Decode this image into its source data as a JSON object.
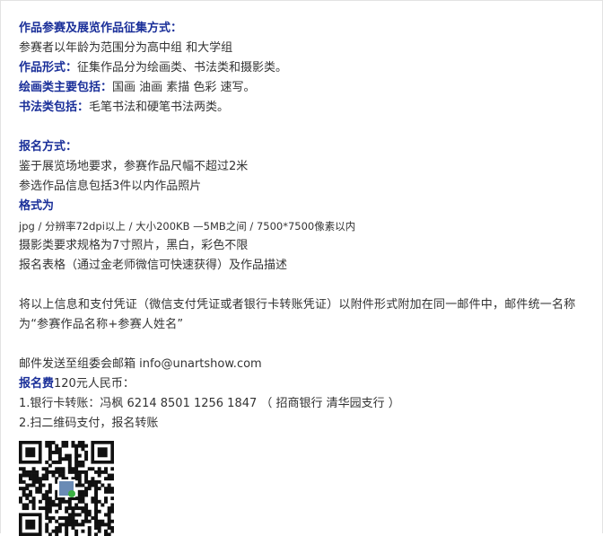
{
  "sections": {
    "works": {
      "heading": "作品参赛及展览作品征集方式：",
      "age_groups": "参赛者以年龄为范围分为高中组 和大学组",
      "forms_label": "作品形式：",
      "forms_text": "征集作品分为绘画类、书法类和摄影类。",
      "painting_label": "绘画类主要包括：",
      "painting_text": "国画 油画 素描 色彩 速写。",
      "calligraphy_label": "书法类包括：",
      "calligraphy_text": "毛笔书法和硬笔书法两类。"
    },
    "registration": {
      "heading": "报名方式：",
      "size_rule": "鉴于展览场地要求，参赛作品尺幅不超过2米",
      "info_rule": "参选作品信息包括3件以内作品照片",
      "format_heading": "格式为",
      "format_spec": "jpg / 分辨率72dpi以上 / 大小200KB —5MB之间 / 7500*7500像素以内",
      "photo_rule": "摄影类要求规格为7寸照片，黑白，彩色不限",
      "form_rule": "报名表格（通过金老师微信可快速获得）及作品描述"
    },
    "submission": {
      "instructions": "将以上信息和支付凭证（微信支付凭证或者银行卡转账凭证）以附件形式附加在同一邮件中，邮件统一名称为“参赛作品名称+参赛人姓名”",
      "email_line": "邮件发送至组委会邮箱 info@unartshow.com"
    },
    "fee": {
      "label": "报名费",
      "amount": "120元人民币：",
      "bank_transfer": "1.银行卡转账：冯枫 6214 8501 1256 1847 （ 招商银行 清华园支行 ）",
      "qr_payment": "2.扫二维码支付，报名转账"
    }
  },
  "colors": {
    "heading": "#1a2f99",
    "body_text": "#333333",
    "qr_green": "#3cb043"
  },
  "icons": {
    "qr": "qr-code-icon"
  }
}
